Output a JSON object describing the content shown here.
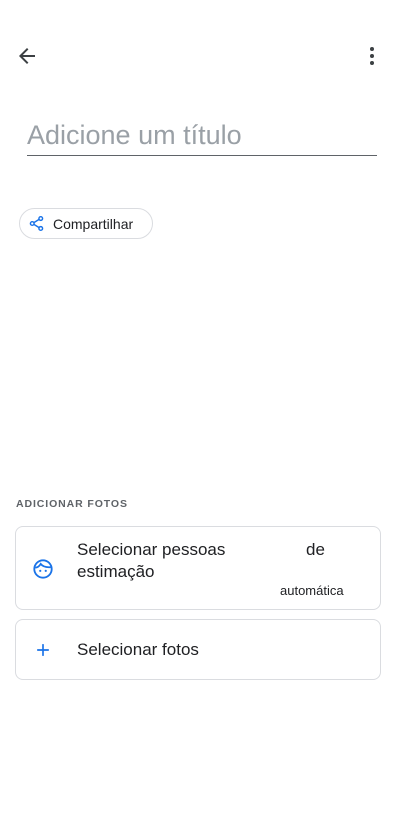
{
  "header": {
    "back_icon": "arrow-back-icon",
    "more_icon": "more-vert-icon"
  },
  "title_field": {
    "value": "",
    "placeholder": "Adicione um título"
  },
  "share": {
    "label": "Compartilhar",
    "icon": "share-icon"
  },
  "add_photos": {
    "section_title": "ADICIONAR FOTOS",
    "pets_option": {
      "label_part1": "Selecionar pessoas",
      "label_part2": "de",
      "label_line2": "estimação",
      "sublabel": "automática",
      "icon": "face-icon"
    },
    "photos_option": {
      "label": "Selecionar fotos",
      "icon": "plus-icon"
    }
  },
  "colors": {
    "accent": "#1a73e8",
    "icon": "#3c4043",
    "border": "#dadce0",
    "placeholder": "#9aa0a6"
  }
}
